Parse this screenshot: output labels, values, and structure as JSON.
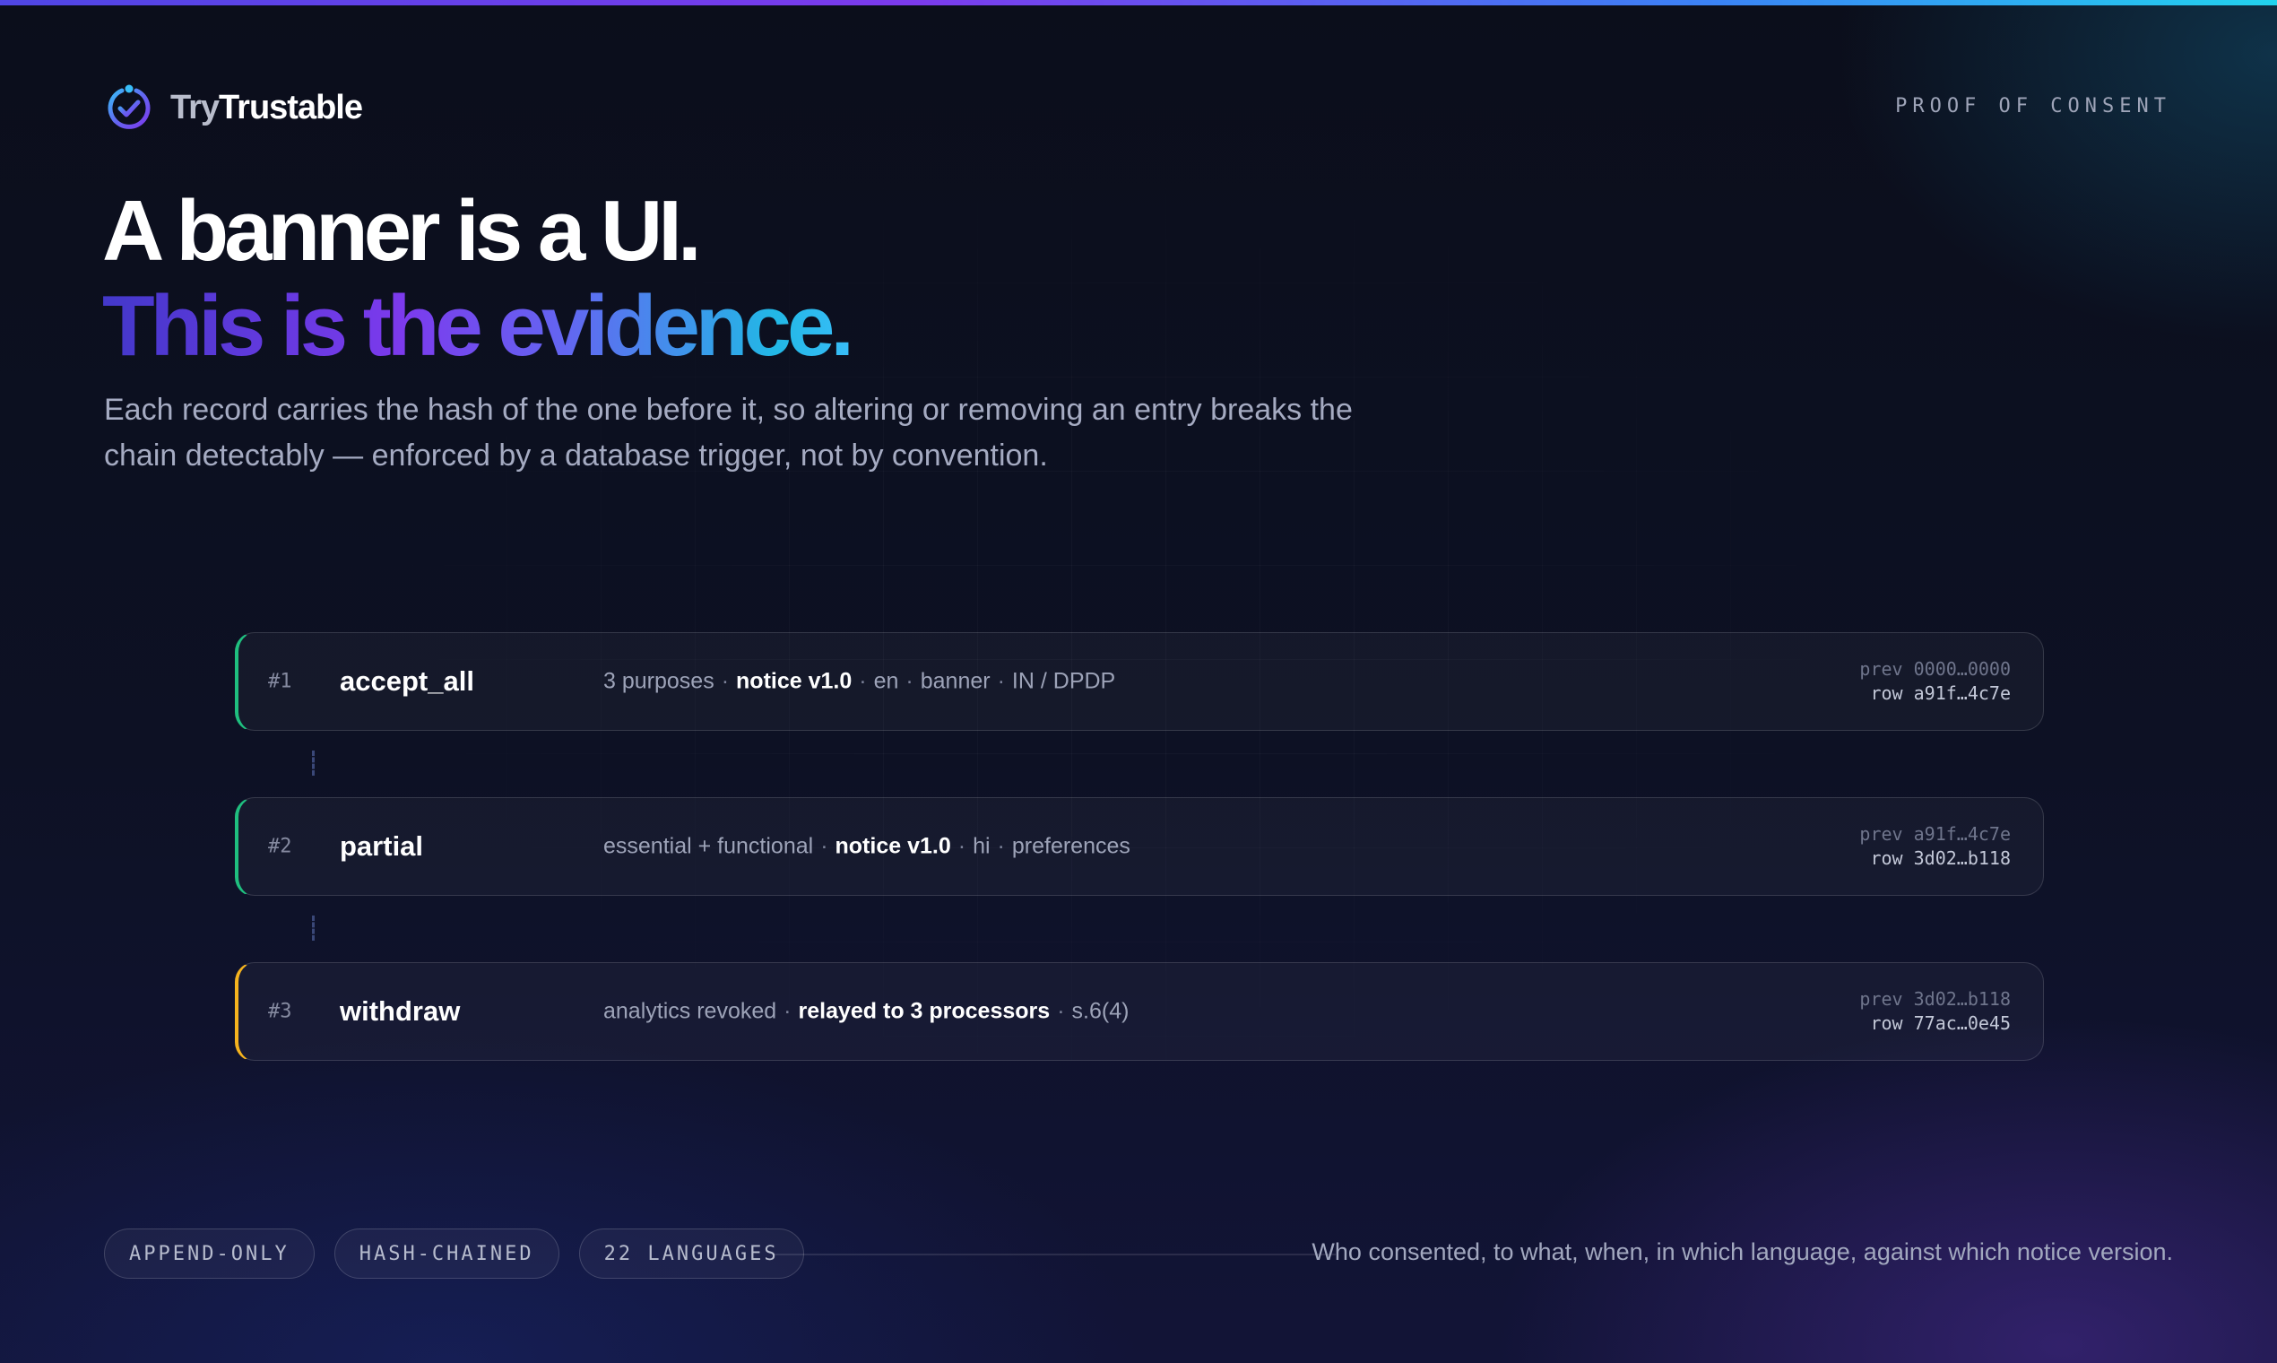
{
  "brand": {
    "logo_try": "Try",
    "logo_rest": "Trustable",
    "logo_icon": "check-circle-icon",
    "kicker": "PROOF OF CONSENT"
  },
  "hero": {
    "line1": "A banner is a UI.",
    "line2": "This is the evidence.",
    "lede": "Each record carries the hash of the one before it, so altering or removing an entry breaks the chain detectably — enforced by a database trigger, not by convention."
  },
  "records": [
    {
      "index": "#1",
      "event": "accept_all",
      "meta": [
        {
          "text": "3 purposes",
          "strong": false
        },
        {
          "text": "notice v1.0",
          "strong": true
        },
        {
          "text": "en",
          "strong": false
        },
        {
          "text": "banner",
          "strong": false
        },
        {
          "text": "IN / DPDP",
          "strong": false
        }
      ],
      "prev": "prev 0000…0000",
      "row": "row a91f…4c7e",
      "accent": "#1fbf7f"
    },
    {
      "index": "#2",
      "event": "partial",
      "meta": [
        {
          "text": "essential + functional",
          "strong": false
        },
        {
          "text": "notice v1.0",
          "strong": true
        },
        {
          "text": "hi",
          "strong": false
        },
        {
          "text": "preferences",
          "strong": false
        }
      ],
      "prev": "prev a91f…4c7e",
      "row": "row 3d02…b118",
      "accent": "#1fbf7f"
    },
    {
      "index": "#3",
      "event": "withdraw",
      "meta": [
        {
          "text": "analytics revoked",
          "strong": false
        },
        {
          "text": "relayed to 3 processors",
          "strong": true
        },
        {
          "text": "s.6(4)",
          "strong": false
        }
      ],
      "prev": "prev 3d02…b118",
      "row": "row 77ac…0e45",
      "accent": "#f5b31e"
    }
  ],
  "footer": {
    "pills": [
      "APPEND-ONLY",
      "HASH-CHAINED",
      "22 LANGUAGES"
    ],
    "tagline": "Who consented, to what, when, in which language, against which notice version."
  },
  "colors": {
    "accent_green": "#1fbf7f",
    "accent_amber": "#f5b31e",
    "gradient_start": "#4338ca",
    "gradient_end": "#38bdf8"
  }
}
